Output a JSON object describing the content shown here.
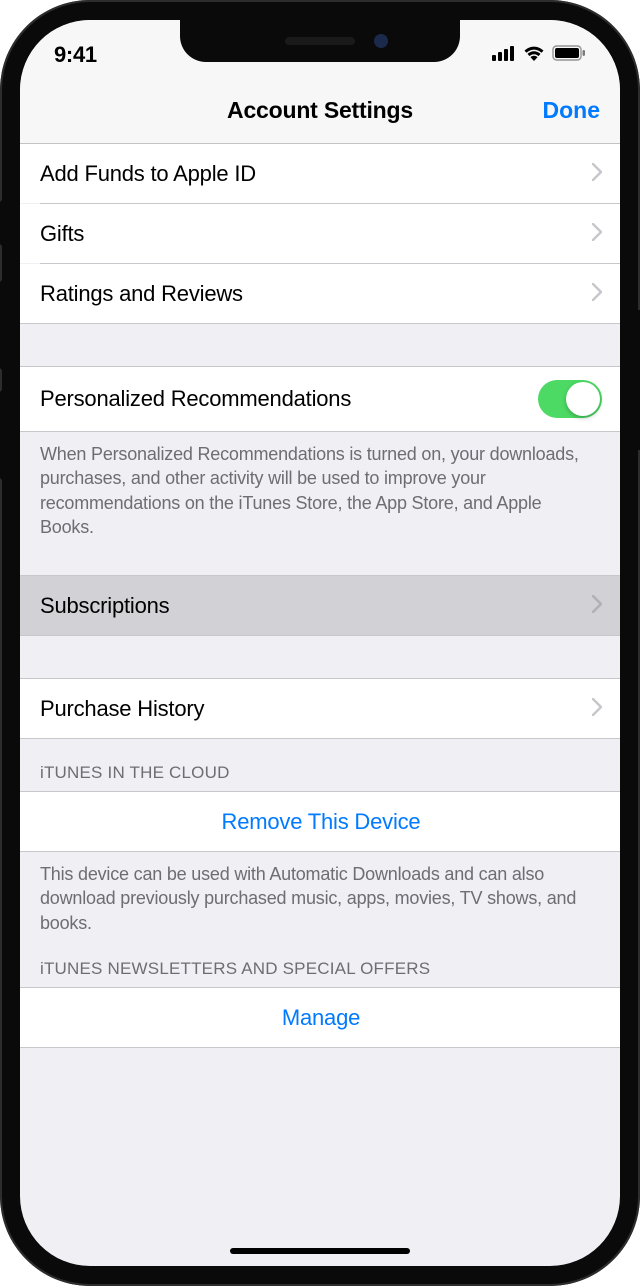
{
  "status": {
    "time": "9:41"
  },
  "nav": {
    "title": "Account Settings",
    "done": "Done"
  },
  "group1": {
    "add_funds": "Add Funds to Apple ID",
    "gifts": "Gifts",
    "ratings": "Ratings and Reviews"
  },
  "recommendations": {
    "label": "Personalized Recommendations",
    "footer": "When Personalized Recommendations is turned on, your downloads, purchases, and other activity will be used to improve your recommendations on the iTunes Store, the App Store, and Apple Books."
  },
  "subscriptions": {
    "label": "Subscriptions"
  },
  "purchase_history": {
    "label": "Purchase History"
  },
  "cloud": {
    "header": "iTUNES IN THE CLOUD",
    "remove": "Remove This Device",
    "footer": "This device can be used with Automatic Downloads and can also download previously purchased music, apps, movies, TV shows, and books."
  },
  "newsletters": {
    "header": "iTUNES NEWSLETTERS AND SPECIAL OFFERS",
    "manage": "Manage"
  }
}
